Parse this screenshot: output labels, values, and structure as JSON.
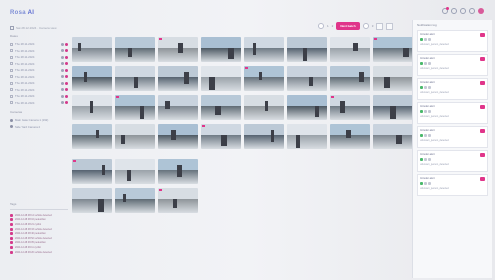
{
  "app": {
    "logo": "Rosa",
    "logo_suffix": "AI"
  },
  "breadcrumb": "Sat 28.12.2024 · Camera view",
  "pager": {
    "label": "Next batch",
    "pages": [
      "1",
      "2",
      "3"
    ],
    "current": "1"
  },
  "sidebar": {
    "dates_title": "Dates",
    "dates": [
      "Thu 28.11.2024",
      "Thu 28.11.2024",
      "Thu 28.11.2024",
      "Thu 28.11.2024",
      "Thu 28.11.2024",
      "Thu 28.11.2024",
      "Thu 28.11.2024",
      "Thu 28.11.2024",
      "Thu 28.11.2024",
      "Thu 28.11.2024"
    ],
    "cameras_title": "Cameras",
    "cameras": [
      "Main Gate Camera 1 (192)",
      "Side Yard Camera 2"
    ],
    "tags_title": "Tags",
    "log": [
      "2024-12-28 08:14  vehicle detected",
      "2024-12-28 08:16  pedestrian",
      "2024-12-28 08:21  cyclist",
      "2024-12-28 08:33  vehicle detected",
      "2024-12-28 08:40  pedestrian",
      "2024-12-28 08:52  vehicle detected",
      "2024-12-28 09:05  pedestrian",
      "2024-12-28 09:11  cyclist",
      "2024-12-28 09:20  vehicle detected"
    ]
  },
  "notifications_title": "Notification log",
  "notifications": [
    {
      "title": "Intruder alert",
      "desc": "unknown_person_detected"
    },
    {
      "title": "Intruder alert",
      "desc": "unknown_person_detected"
    },
    {
      "title": "Intruder alert",
      "desc": "unknown_person_detected"
    },
    {
      "title": "Intruder alert",
      "desc": "unknown_person_detected"
    },
    {
      "title": "Intruder alert",
      "desc": "unknown_person_detected"
    },
    {
      "title": "Intruder alert",
      "desc": "unknown_person_detected"
    },
    {
      "title": "Intruder alert",
      "desc": "unknown_person_detected"
    }
  ],
  "colors": {
    "accent": "#e0358a",
    "brand": "#6a7ad6"
  }
}
